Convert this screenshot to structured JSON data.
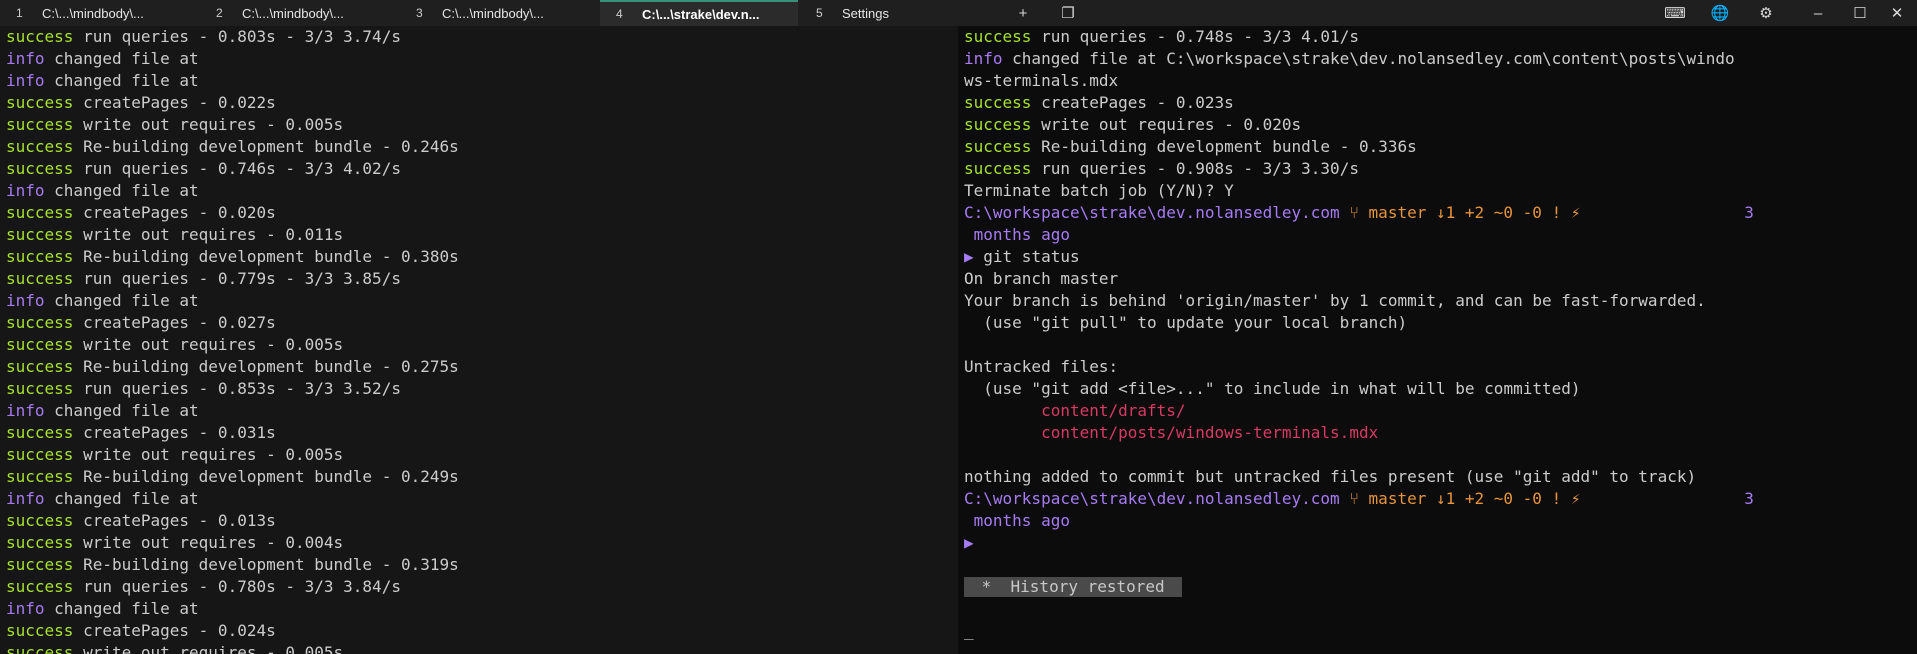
{
  "tabs": [
    {
      "num": "1",
      "title": "C:\\...\\mindbody\\...",
      "active": false
    },
    {
      "num": "2",
      "title": "C:\\...\\mindbody\\...",
      "active": false
    },
    {
      "num": "3",
      "title": "C:\\...\\mindbody\\...",
      "active": false
    },
    {
      "num": "4",
      "title": "C:\\...\\strake\\dev.n...",
      "active": true
    },
    {
      "num": "5",
      "title": "Settings",
      "active": false
    }
  ],
  "toolbar": {
    "new_tab_icon": "+",
    "dup_tab_icon": "❐",
    "keyboard_icon": "⌨",
    "globe_icon": "🌐",
    "gear_icon": "⚙",
    "minimize_icon": "–",
    "maximize_icon": "☐",
    "close_icon": "✕"
  },
  "left_pane": [
    [
      [
        "green",
        "success"
      ],
      [
        "gray",
        " run queries - 0.803s - 3/3 3.74/s"
      ]
    ],
    [
      [
        "purple",
        "info"
      ],
      [
        "gray",
        " changed file at"
      ]
    ],
    [
      [
        "purple",
        "info"
      ],
      [
        "gray",
        " changed file at"
      ]
    ],
    [
      [
        "green",
        "success"
      ],
      [
        "gray",
        " createPages - 0.022s"
      ]
    ],
    [
      [
        "green",
        "success"
      ],
      [
        "gray",
        " write out requires - 0.005s"
      ]
    ],
    [
      [
        "green",
        "success"
      ],
      [
        "gray",
        " Re-building development bundle - 0.246s"
      ]
    ],
    [
      [
        "green",
        "success"
      ],
      [
        "gray",
        " run queries - 0.746s - 3/3 4.02/s"
      ]
    ],
    [
      [
        "purple",
        "info"
      ],
      [
        "gray",
        " changed file at"
      ]
    ],
    [
      [
        "green",
        "success"
      ],
      [
        "gray",
        " createPages - 0.020s"
      ]
    ],
    [
      [
        "green",
        "success"
      ],
      [
        "gray",
        " write out requires - 0.011s"
      ]
    ],
    [
      [
        "green",
        "success"
      ],
      [
        "gray",
        " Re-building development bundle - 0.380s"
      ]
    ],
    [
      [
        "green",
        "success"
      ],
      [
        "gray",
        " run queries - 0.779s - 3/3 3.85/s"
      ]
    ],
    [
      [
        "purple",
        "info"
      ],
      [
        "gray",
        " changed file at"
      ]
    ],
    [
      [
        "green",
        "success"
      ],
      [
        "gray",
        " createPages - 0.027s"
      ]
    ],
    [
      [
        "green",
        "success"
      ],
      [
        "gray",
        " write out requires - 0.005s"
      ]
    ],
    [
      [
        "green",
        "success"
      ],
      [
        "gray",
        " Re-building development bundle - 0.275s"
      ]
    ],
    [
      [
        "green",
        "success"
      ],
      [
        "gray",
        " run queries - 0.853s - 3/3 3.52/s"
      ]
    ],
    [
      [
        "purple",
        "info"
      ],
      [
        "gray",
        " changed file at"
      ]
    ],
    [
      [
        "green",
        "success"
      ],
      [
        "gray",
        " createPages - 0.031s"
      ]
    ],
    [
      [
        "green",
        "success"
      ],
      [
        "gray",
        " write out requires - 0.005s"
      ]
    ],
    [
      [
        "green",
        "success"
      ],
      [
        "gray",
        " Re-building development bundle - 0.249s"
      ]
    ],
    [
      [
        "purple",
        "info"
      ],
      [
        "gray",
        " changed file at"
      ]
    ],
    [
      [
        "green",
        "success"
      ],
      [
        "gray",
        " createPages - 0.013s"
      ]
    ],
    [
      [
        "green",
        "success"
      ],
      [
        "gray",
        " write out requires - 0.004s"
      ]
    ],
    [
      [
        "green",
        "success"
      ],
      [
        "gray",
        " Re-building development bundle - 0.319s"
      ]
    ],
    [
      [
        "green",
        "success"
      ],
      [
        "gray",
        " run queries - 0.780s - 3/3 3.84/s"
      ]
    ],
    [
      [
        "purple",
        "info"
      ],
      [
        "gray",
        " changed file at"
      ]
    ],
    [
      [
        "green",
        "success"
      ],
      [
        "gray",
        " createPages - 0.024s"
      ]
    ],
    [
      [
        "green",
        "success"
      ],
      [
        "gray",
        " write out requires - 0.005s"
      ]
    ]
  ],
  "right_pane": [
    [
      [
        "green",
        "success"
      ],
      [
        "gray",
        " run queries - 0.748s - 3/3 4.01/s"
      ]
    ],
    [
      [
        "purple",
        "info"
      ],
      [
        "gray",
        " changed file at C:\\workspace\\strake\\dev.nolansedley.com\\content\\posts\\windo"
      ]
    ],
    [
      [
        "gray",
        "ws-terminals.mdx"
      ]
    ],
    [
      [
        "green",
        "success"
      ],
      [
        "gray",
        " createPages - 0.023s"
      ]
    ],
    [
      [
        "green",
        "success"
      ],
      [
        "gray",
        " write out requires - 0.020s"
      ]
    ],
    [
      [
        "green",
        "success"
      ],
      [
        "gray",
        " Re-building development bundle - 0.336s"
      ]
    ],
    [
      [
        "green",
        "success"
      ],
      [
        "gray",
        " run queries - 0.908s - 3/3 3.30/s"
      ]
    ],
    [
      [
        "gray",
        "Terminate batch job (Y/N)? Y"
      ]
    ],
    [
      [
        "purple",
        "C:\\workspace\\strake\\dev.nolansedley.com"
      ],
      [
        "orange",
        " ⑂ master ↓1 +2 ~0 -0 ! ⚡"
      ],
      [
        "purple",
        "                 3"
      ]
    ],
    [
      [
        "purple",
        " months ago"
      ]
    ],
    [
      [
        "purple",
        "▶"
      ],
      [
        "gray",
        " git status"
      ]
    ],
    [
      [
        "gray",
        "On branch master"
      ]
    ],
    [
      [
        "gray",
        "Your branch is behind 'origin/master' by 1 commit, and can be fast-forwarded."
      ]
    ],
    [
      [
        "gray",
        "  (use \"git pull\" to update your local branch)"
      ]
    ],
    [
      [
        "gray",
        ""
      ]
    ],
    [
      [
        "gray",
        "Untracked files:"
      ]
    ],
    [
      [
        "gray",
        "  (use \"git add <file>...\" to include in what will be committed)"
      ]
    ],
    [
      [
        "red",
        "        content/drafts/"
      ]
    ],
    [
      [
        "red",
        "        content/posts/windows-terminals.mdx"
      ]
    ],
    [
      [
        "gray",
        ""
      ]
    ],
    [
      [
        "gray",
        "nothing added to commit but untracked files present (use \"git add\" to track)"
      ]
    ],
    [
      [
        "purple",
        "C:\\workspace\\strake\\dev.nolansedley.com"
      ],
      [
        "orange",
        " ⑂ master ↓1 +2 ~0 -0 ! ⚡"
      ],
      [
        "purple",
        "                 3"
      ]
    ],
    [
      [
        "purple",
        " months ago"
      ]
    ],
    [
      [
        "purple",
        "▶"
      ]
    ],
    [
      [
        "gray",
        ""
      ]
    ],
    [
      [
        "badge",
        " *  History restored "
      ]
    ],
    [
      [
        "gray",
        ""
      ]
    ],
    [
      [
        "gray",
        "_"
      ]
    ]
  ],
  "colors": {
    "success": "#a6e22e",
    "info": "#a77bf3",
    "accent_tab": "#3a8f7a"
  }
}
